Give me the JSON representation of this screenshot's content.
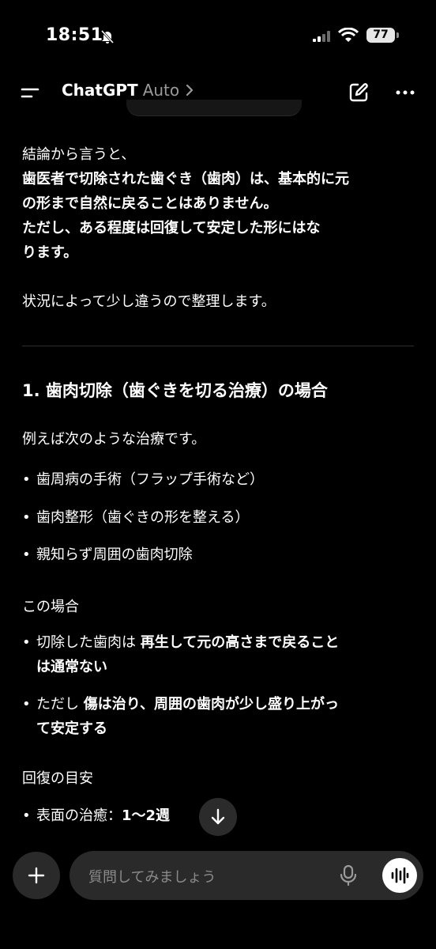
{
  "status_bar": {
    "time": "18:51",
    "battery": "77"
  },
  "header": {
    "title": "ChatGPT",
    "model": "Auto",
    "chevron": ">"
  },
  "message": {
    "intro": "結論から言うと、",
    "conclusion_line1": "歯医者で切除された歯ぐき（歯肉）は、基本的に元",
    "conclusion_line2": "の形まで自然に戻ることはありません。",
    "note_line1": "ただし、ある程度は回復して安定した形にはな",
    "note_line2": "ります。",
    "organize": "状況によって少し違うので整理します。",
    "section1_heading": "1. 歯肉切除（歯ぐきを切る治療）の場合",
    "examples_intro": "例えば次のような治療です。",
    "examples": [
      "歯周病の手術（フラップ手術など）",
      "歯肉整形（歯ぐきの形を整える）",
      "親知らず周囲の歯肉切除"
    ],
    "case_label": "この場合",
    "case_items": [
      {
        "pre": "切除した歯肉は ",
        "bold_1": "再生して元の高さまで戻ること",
        "bold_2": "は通常ない"
      },
      {
        "pre": "ただし ",
        "bold_1": "傷は治り、周囲の歯肉が少し盛り上がっ",
        "bold_2": "て安定する"
      }
    ],
    "recovery_label": "回復の目安",
    "recovery_item_prefix": "表面の治癒：",
    "recovery_item_value": "1〜2週"
  },
  "composer": {
    "placeholder": "質問してみましょう"
  },
  "icons": {
    "bell": "bell-slash-icon",
    "signal": "cellular-signal-icon",
    "wifi": "wifi-icon",
    "menu": "menu-icon",
    "edit": "new-chat-icon",
    "more": "more-icon",
    "scroll": "arrow-down-icon",
    "plus": "plus-icon",
    "mic": "microphone-icon",
    "voice": "voice-mode-icon"
  }
}
